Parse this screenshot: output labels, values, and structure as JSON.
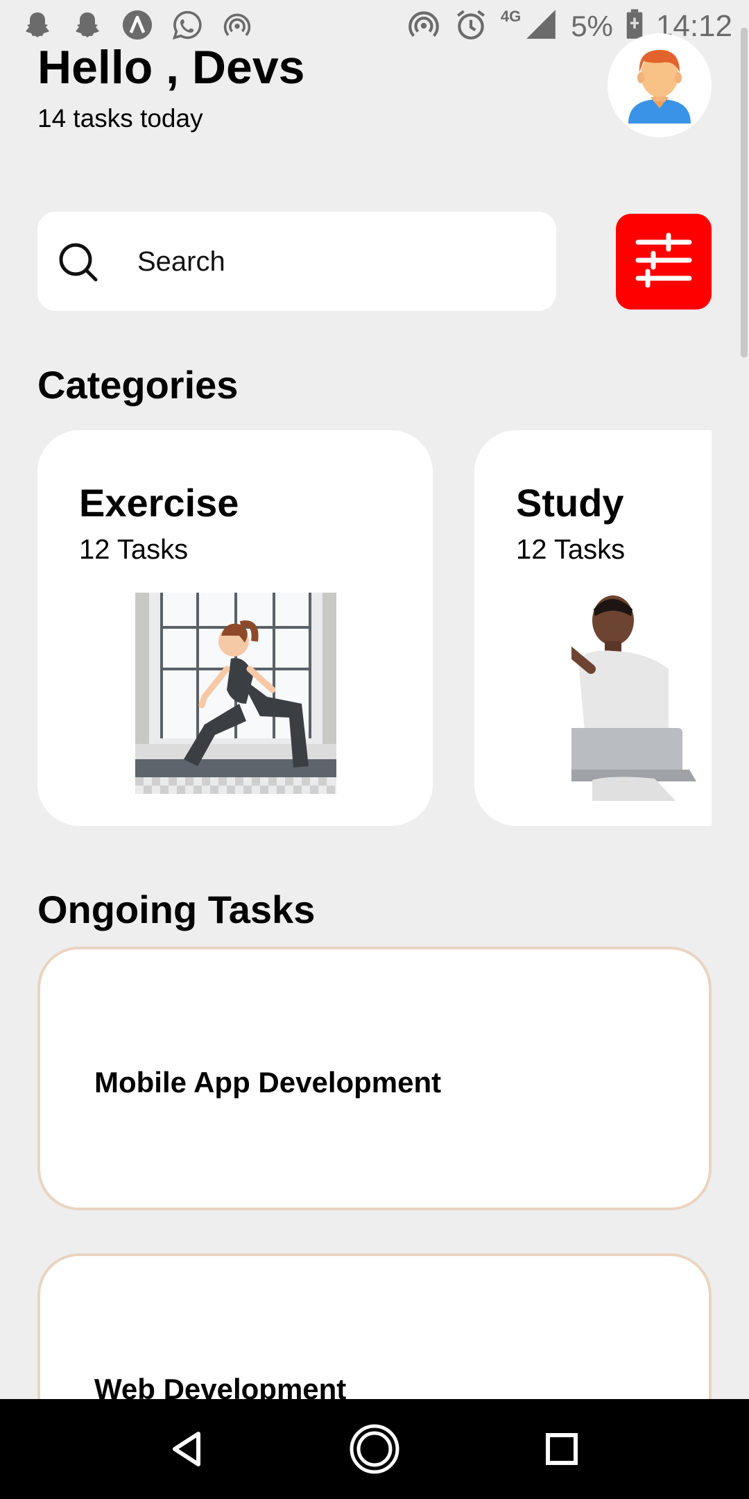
{
  "status_bar": {
    "left_icons": [
      "snapchat-icon",
      "snapchat-icon",
      "arc-app-icon",
      "whatsapp-icon",
      "hotspot-icon"
    ],
    "network": "4G",
    "battery": "5%",
    "time": "14:12"
  },
  "header": {
    "greeting": "Hello , Devs",
    "subtitle": "14 tasks today",
    "avatar_icon": "person-avatar-icon"
  },
  "search": {
    "placeholder": "Search",
    "filter_icon": "sliders-icon"
  },
  "categories": {
    "title": "Categories",
    "items": [
      {
        "title": "Exercise",
        "count": "12 Tasks",
        "image": "yoga-woman-illustration"
      },
      {
        "title": "Study",
        "count": "12 Tasks",
        "image": "student-laptop-illustration"
      }
    ]
  },
  "ongoing": {
    "title": "Ongoing Tasks",
    "items": [
      {
        "title": "Mobile App Development"
      },
      {
        "title": "Web Development"
      }
    ]
  },
  "nav": {
    "back_icon": "back-triangle-icon",
    "home_icon": "home-circle-icon",
    "recents_icon": "recents-square-icon"
  },
  "colors": {
    "background": "#eeeeee",
    "filter_button": "#ff0000",
    "task_border": "#ead4c0",
    "card": "#ffffff"
  }
}
